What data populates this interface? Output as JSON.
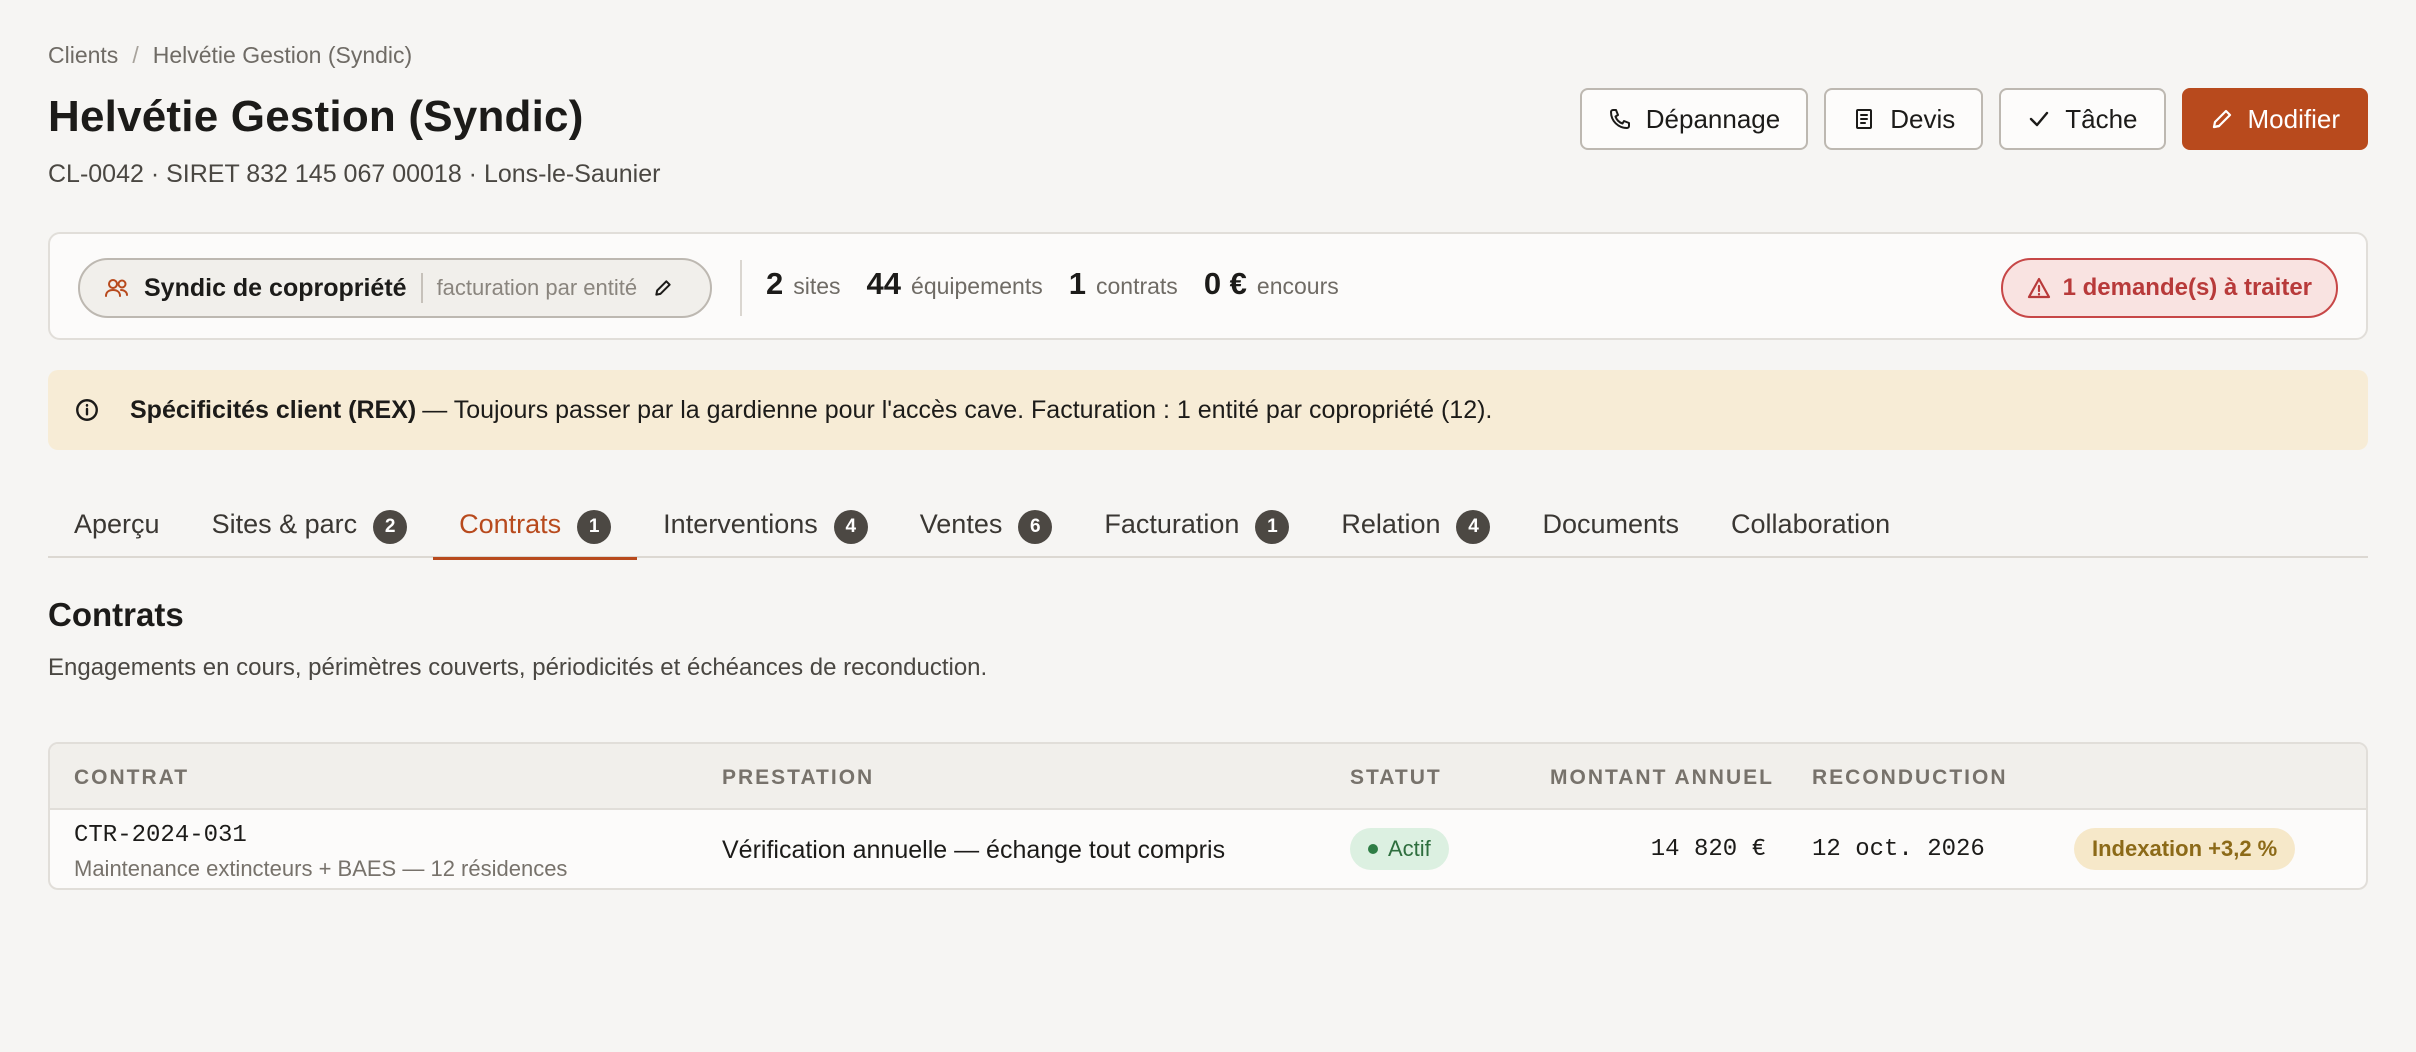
{
  "breadcrumb": {
    "parent": "Clients",
    "separator": "/",
    "current": "Helvétie Gestion (Syndic)"
  },
  "header": {
    "title": "Helvétie Gestion (Syndic)",
    "subtitle": "CL-0042 · SIRET 832 145 067 00018 · Lons-le-Saunier"
  },
  "actions": {
    "depannage": "Dépannage",
    "devis": "Devis",
    "tache": "Tâche",
    "modifier": "Modifier"
  },
  "summary": {
    "client_type": "Syndic de copropriété",
    "billing_mode": "facturation par entité",
    "stats": [
      {
        "value": "2",
        "label": "sites"
      },
      {
        "value": "44",
        "label": "équipements"
      },
      {
        "value": "1",
        "label": "contrats"
      },
      {
        "value": "0 €",
        "label": "encours"
      }
    ],
    "alert": "1 demande(s) à traiter"
  },
  "rex": {
    "title": "Spécificités client (REX)",
    "text": "— Toujours passer par la gardienne pour l'accès cave. Facturation : 1 entité par copropriété (12)."
  },
  "tabs": [
    {
      "label": "Aperçu",
      "count": null
    },
    {
      "label": "Sites & parc",
      "count": "2"
    },
    {
      "label": "Contrats",
      "count": "1",
      "active": true
    },
    {
      "label": "Interventions",
      "count": "4"
    },
    {
      "label": "Ventes",
      "count": "6"
    },
    {
      "label": "Facturation",
      "count": "1"
    },
    {
      "label": "Relation",
      "count": "4"
    },
    {
      "label": "Documents",
      "count": null
    },
    {
      "label": "Collaboration",
      "count": null
    }
  ],
  "section": {
    "title": "Contrats",
    "description": "Engagements en cours, périmètres couverts, périodicités et échéances de reconduction."
  },
  "table": {
    "headers": {
      "contrat": "CONTRAT",
      "prestation": "PRESTATION",
      "statut": "STATUT",
      "montant": "MONTANT ANNUEL",
      "reconduction": "RECONDUCTION"
    },
    "rows": [
      {
        "id": "CTR-2024-031",
        "description": "Maintenance extincteurs + BAES — 12 résidences",
        "prestation": "Vérification annuelle — échange tout compris",
        "statut": "Actif",
        "montant": "14 820 €",
        "reconduction": "12 oct. 2026",
        "tag": "Indexation +3,2 %"
      }
    ]
  },
  "colors": {
    "accent": "#b84a1d",
    "alert": "#b83a3a",
    "success": "#2e6e3e",
    "banner": "#f7ecd6"
  }
}
